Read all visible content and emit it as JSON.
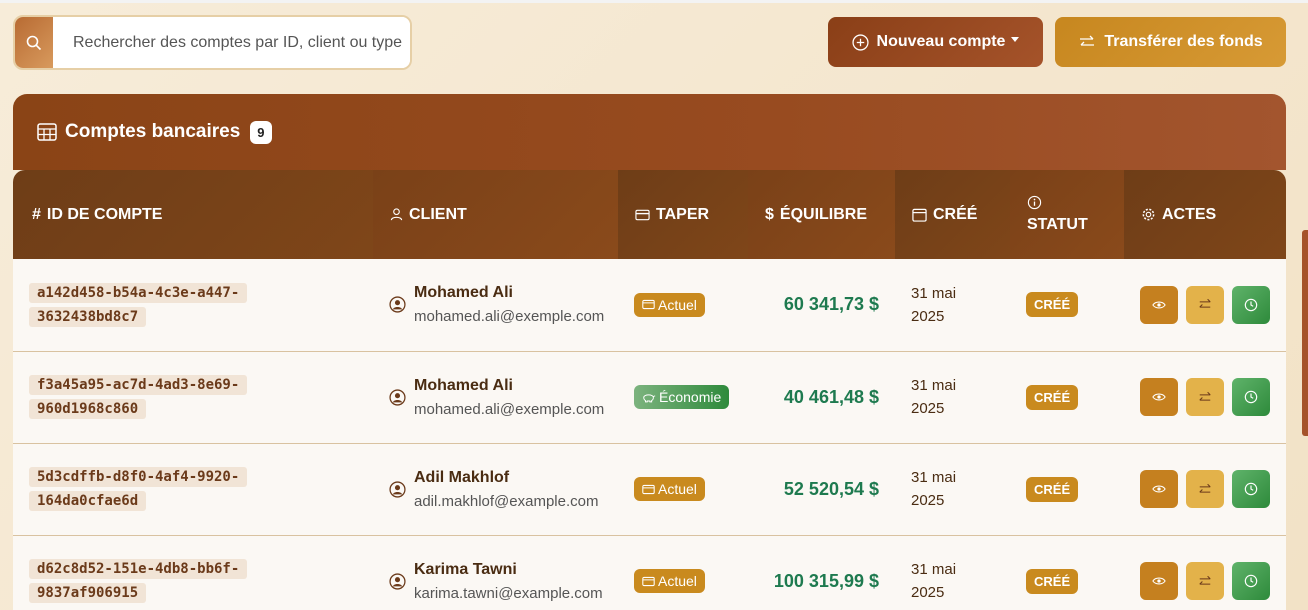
{
  "search": {
    "placeholder": "Rechercher des comptes par ID, client ou type"
  },
  "toolbar": {
    "new_account_label": "Nouveau compte",
    "transfer_label": "Transférer des fonds"
  },
  "card": {
    "title": "Comptes bancaires",
    "count": "9"
  },
  "columns": {
    "id": "ID DE COMPTE",
    "client": "CLIENT",
    "type": "TAPER",
    "balance": "ÉQUILIBRE",
    "created": "CRÉÉ",
    "status": "STATUT",
    "actions": "ACTES"
  },
  "rows": [
    {
      "id_line1": "a142d458-b54a-4c3e-a447-",
      "id_line2": "3632438bd8c7",
      "client_name": "Mohamed Ali",
      "client_email": "mohamed.ali@exemple.com",
      "type": "Actuel",
      "balance": "60 341,73 $",
      "created_line1": "31 mai",
      "created_line2": "2025",
      "status": "CRÉÉ"
    },
    {
      "id_line1": "f3a45a95-ac7d-4ad3-8e69-",
      "id_line2": "960d1968c860",
      "client_name": "Mohamed Ali",
      "client_email": "mohamed.ali@exemple.com",
      "type": "Économie",
      "balance": "40 461,48 $",
      "created_line1": "31 mai",
      "created_line2": "2025",
      "status": "CRÉÉ"
    },
    {
      "id_line1": "5d3cdffb-d8f0-4af4-9920-",
      "id_line2": "164da0cfae6d",
      "client_name": "Adil Makhlof",
      "client_email": "adil.makhlof@example.com",
      "type": "Actuel",
      "balance": "52 520,54 $",
      "created_line1": "31 mai",
      "created_line2": "2025",
      "status": "CRÉÉ"
    },
    {
      "id_line1": "d62c8d52-151e-4db8-bb6f-",
      "id_line2": "9837af906915",
      "client_name": "Karima Tawni",
      "client_email": "karima.tawni@example.com",
      "type": "Actuel",
      "balance": "100 315,99 $",
      "created_line1": "31 mai",
      "created_line2": "2025",
      "status": "CRÉÉ"
    }
  ],
  "colors": {
    "accent_brown": "#8a4416",
    "gold": "#c98a1e",
    "green_balance": "#1e7a4f"
  }
}
